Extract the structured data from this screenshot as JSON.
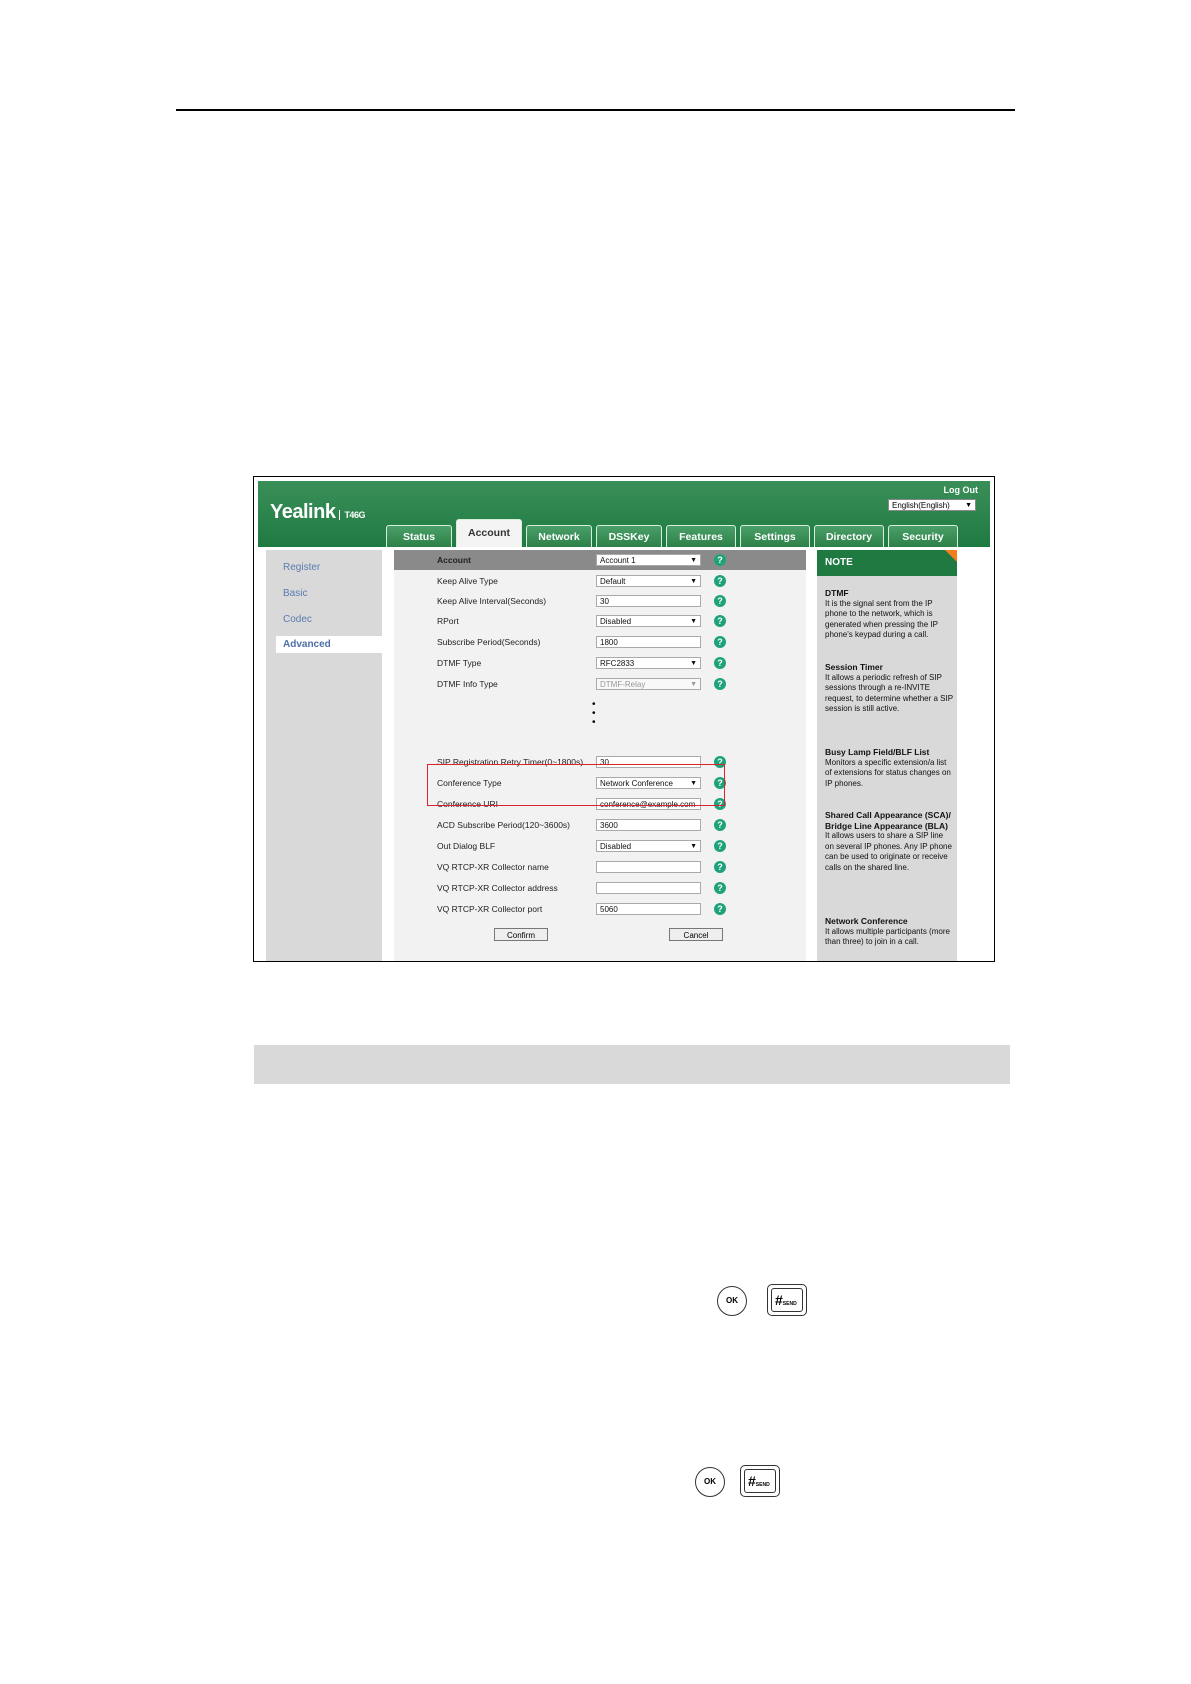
{
  "header": {
    "brand": "Yealink",
    "model": "T46G",
    "logout": "Log Out",
    "language": "English(English)"
  },
  "tabs": [
    "Status",
    "Account",
    "Network",
    "DSSKey",
    "Features",
    "Settings",
    "Directory",
    "Security"
  ],
  "active_tab": "Account",
  "sidebar": {
    "items": [
      "Register",
      "Basic",
      "Codec",
      "Advanced"
    ],
    "active": "Advanced"
  },
  "form": {
    "account_label": "Account",
    "account_value": "Account 1",
    "rows": [
      {
        "label": "Keep Alive Type",
        "value": "Default",
        "kind": "select"
      },
      {
        "label": "Keep Alive Interval(Seconds)",
        "value": "30",
        "kind": "input"
      },
      {
        "label": "RPort",
        "value": "Disabled",
        "kind": "select"
      },
      {
        "label": "Subscribe Period(Seconds)",
        "value": "1800",
        "kind": "input"
      },
      {
        "label": "DTMF Type",
        "value": "RFC2833",
        "kind": "select"
      },
      {
        "label": "DTMF Info Type",
        "value": "DTMF-Relay",
        "kind": "select-disabled"
      }
    ],
    "rows2": [
      {
        "label": "SIP Registration Retry Timer(0~1800s)",
        "value": "30",
        "kind": "input"
      },
      {
        "label": "Conference Type",
        "value": "Network Conference",
        "kind": "select"
      },
      {
        "label": "Conference URI",
        "value": "conference@example.com",
        "kind": "input"
      },
      {
        "label": "ACD Subscribe Period(120~3600s)",
        "value": "3600",
        "kind": "input"
      },
      {
        "label": "Out Dialog BLF",
        "value": "Disabled",
        "kind": "select"
      },
      {
        "label": "VQ RTCP-XR Collector name",
        "value": "",
        "kind": "input"
      },
      {
        "label": "VQ RTCP-XR Collector address",
        "value": "",
        "kind": "input"
      },
      {
        "label": "VQ RTCP-XR Collector port",
        "value": "5060",
        "kind": "input"
      }
    ],
    "help_glyph": "?",
    "confirm": "Confirm",
    "cancel": "Cancel"
  },
  "note": {
    "title": "NOTE",
    "sections": [
      {
        "heading": "DTMF",
        "body": "It is the signal sent from the IP phone to the network, which is generated when pressing the IP phone's keypad during a call."
      },
      {
        "heading": "Session Timer",
        "body": "It allows a periodic refresh of SIP sessions through a re-INVITE request, to determine whether a SIP session is still active."
      },
      {
        "heading": "Busy Lamp Field/BLF List",
        "body": "Monitors a specific extension/a list of extensions for status changes on IP phones."
      },
      {
        "heading": "Shared Call Appearance (SCA)/ Bridge Line Appearance (BLA)",
        "body": "It allows users to share a SIP line on several IP phones. Any IP phone can be used to originate or receive calls on the shared line."
      },
      {
        "heading": "Network Conference",
        "body": "It allows multiple participants (more than three) to join in a call."
      }
    ]
  },
  "keys": {
    "ok_label": "OK",
    "hash_label": "#",
    "send_label": "SEND"
  }
}
